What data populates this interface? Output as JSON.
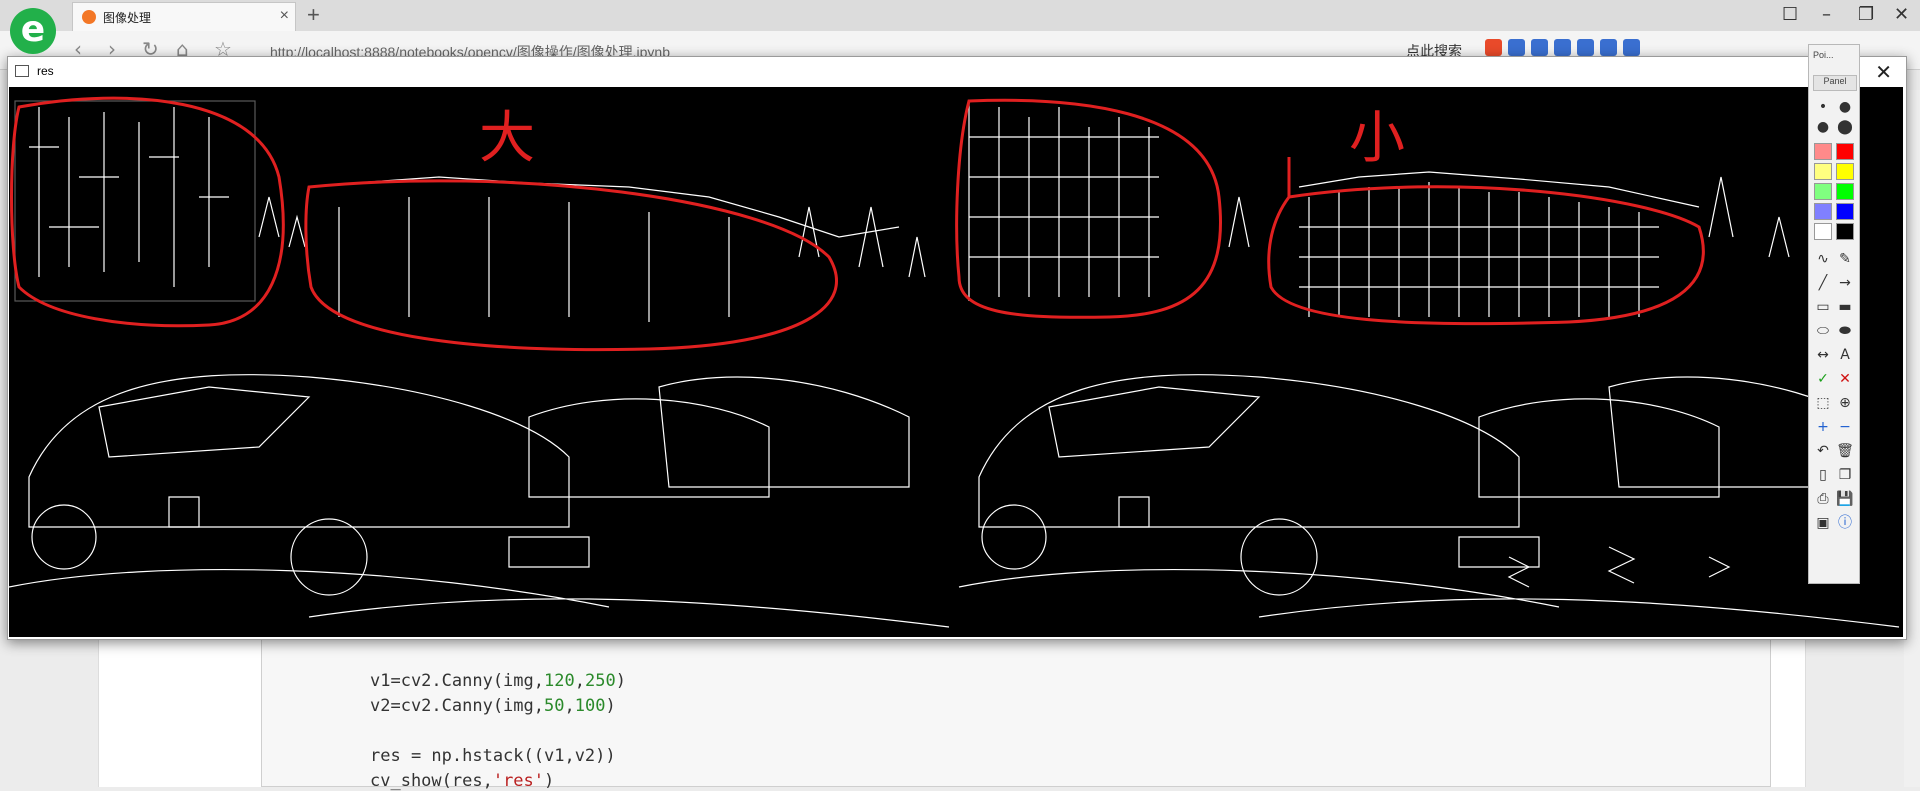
{
  "browser": {
    "tab_title": "图像处理",
    "tab_close": "×",
    "new_tab": "+",
    "url": "http://localhost:8888/notebooks/opencv/图像操作/图像处理.ipynb",
    "search_label": "点此搜索",
    "window_buttons": [
      "☐",
      "–",
      "❐",
      "✕"
    ],
    "nav": [
      "‹",
      "›",
      "↻",
      "⌂",
      "☆"
    ]
  },
  "res_window": {
    "title": "res",
    "close": "✕"
  },
  "notebook": {
    "code_lines": [
      {
        "pre": "v1=cv2.Canny(img,",
        "a": "120",
        "sep": ",",
        "b": "250",
        "post": ")"
      },
      {
        "pre": "v2=cv2.Canny(img,",
        "a": "50",
        "sep": ",",
        "b": "100",
        "post": ")"
      },
      {
        "text": "res = np.hstack((v1,v2))"
      },
      {
        "pre": "cv_show(res,",
        "s": "'res'",
        "post": ")"
      }
    ]
  },
  "annotations": {
    "left_label": "大",
    "right_label": "小",
    "stroke_color": "#e02020"
  },
  "palette": {
    "title": "Poi...",
    "tab": "Panel",
    "colors": [
      "#ff8a8a",
      "#ff0000",
      "#ffff80",
      "#ffff00",
      "#80ff80",
      "#00ff00",
      "#8080ff",
      "#0000ff",
      "#ffffff",
      "#000000"
    ],
    "tool_icons": [
      "pen-icon",
      "eraser-icon",
      "line-icon",
      "arrow-icon",
      "rect-icon",
      "filled-rect-icon",
      "ellipse-icon",
      "filled-ellipse-icon",
      "double-arrow-icon",
      "text-icon",
      "check-icon",
      "delete-icon",
      "crop-icon",
      "zoom-icon",
      "plus-icon",
      "minus-icon",
      "undo-icon",
      "trash-icon",
      "new-page-icon",
      "copy-icon",
      "print-icon",
      "save-icon",
      "image-icon",
      "info-icon"
    ]
  }
}
